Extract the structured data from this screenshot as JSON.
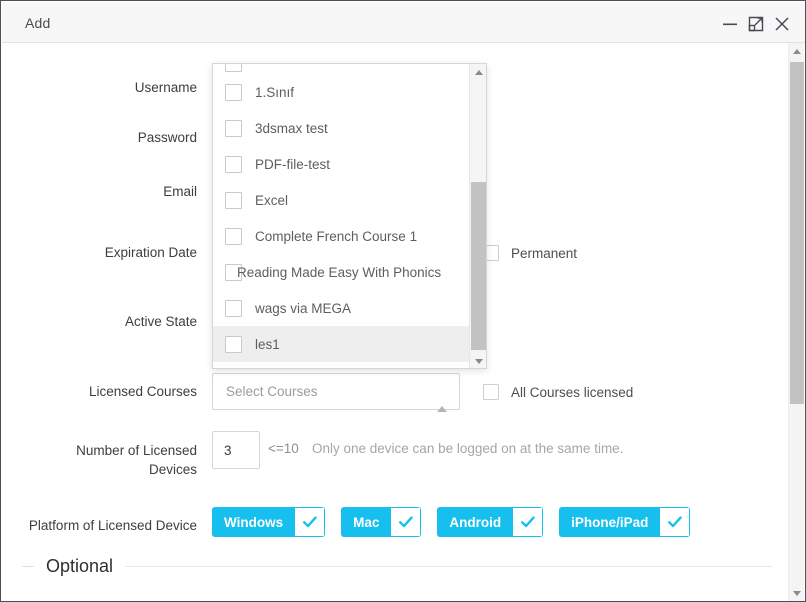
{
  "window": {
    "title": "Add",
    "controls": {
      "minimize": "minimize-icon",
      "maximize": "maximize-restore-icon",
      "close": "close-icon"
    }
  },
  "form": {
    "labels": {
      "username": "Username",
      "password": "Password",
      "email": "Email",
      "expiration_date": "Expiration Date",
      "active_state": "Active State",
      "licensed_courses": "Licensed Courses",
      "number_of_licensed_devices": "Number of Licensed Devices",
      "platform_of_licensed_device": "Platform of Licensed Device"
    },
    "permanent": {
      "label": "Permanent",
      "checked": false
    },
    "licensed_courses": {
      "placeholder": "Select Courses",
      "value": "",
      "caret": "chevron-up-icon",
      "expanded": true
    },
    "all_courses_licensed": {
      "label": "All Courses licensed",
      "checked": false
    },
    "devices": {
      "value": "3",
      "limit": "<=10",
      "hint": "Only one device can be logged on at the same time."
    },
    "platforms": [
      {
        "name": "Windows",
        "selected": true
      },
      {
        "name": "Mac",
        "selected": true
      },
      {
        "name": "Android",
        "selected": true
      },
      {
        "name": "iPhone/iPad",
        "selected": true
      }
    ],
    "optional_section_label": "Optional"
  },
  "courses_dropdown": {
    "items": [
      {
        "label": "1.Sınıf",
        "checked": false,
        "hovered": false,
        "overflow": false
      },
      {
        "label": "3dsmax test",
        "checked": false,
        "hovered": false,
        "overflow": false
      },
      {
        "label": "PDF-file-test",
        "checked": false,
        "hovered": false,
        "overflow": false
      },
      {
        "label": "Excel",
        "checked": false,
        "hovered": false,
        "overflow": false
      },
      {
        "label": "Complete French Course 1",
        "checked": false,
        "hovered": false,
        "overflow": false
      },
      {
        "label": "Reading Made Easy With Phonics",
        "checked": false,
        "hovered": false,
        "overflow": true
      },
      {
        "label": "wags via MEGA",
        "checked": false,
        "hovered": false,
        "overflow": false
      },
      {
        "label": "les1",
        "checked": false,
        "hovered": true,
        "overflow": false
      }
    ],
    "scrollbar": {
      "up_arrow": "scroll-up-arrow-icon",
      "down_arrow": "scroll-down-arrow-icon"
    }
  },
  "main_scrollbar": {
    "up_arrow": "scroll-up-arrow-icon",
    "down_arrow": "scroll-down-arrow-icon"
  },
  "colors": {
    "accent_cyan": "#17bfee",
    "titlebar_bg": "#f7f7f7",
    "text_primary": "#3d3d42",
    "text_muted": "#a6a6aa",
    "scrollbar_thumb": "#c2c2c2"
  }
}
